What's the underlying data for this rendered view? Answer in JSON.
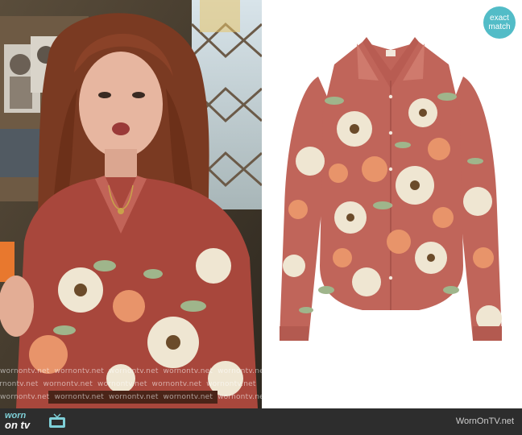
{
  "badge": {
    "line1": "exact",
    "line2": "match",
    "color": "#52bcc7"
  },
  "watermark": {
    "text": "wornontv.net",
    "rows": [
      [
        "wornontv.net",
        "wornontv.net",
        "wornontv.net",
        "wornontv.net",
        "wornontv.net"
      ],
      [
        "wornontv.net",
        "wornontv.net",
        "wornontv.net",
        "wornontv.net",
        "wornontv.net"
      ],
      [
        "wornontv.net",
        "wornontv.net",
        "wornontv.net",
        "wornontv.net",
        "wornontv.net"
      ]
    ]
  },
  "footer": {
    "logo_line1": "worn",
    "logo_line2": "on tv",
    "credit": "WornOnTV.net",
    "background": "#2d2d2d"
  },
  "colors": {
    "shirt_base": "#c0655a",
    "flower_cream": "#efe6d2",
    "flower_peach": "#e8946a",
    "leaf_sage": "#9fb58b",
    "hair": "#7a3a22"
  },
  "icons": [
    "tv-icon",
    "camera-icon"
  ]
}
